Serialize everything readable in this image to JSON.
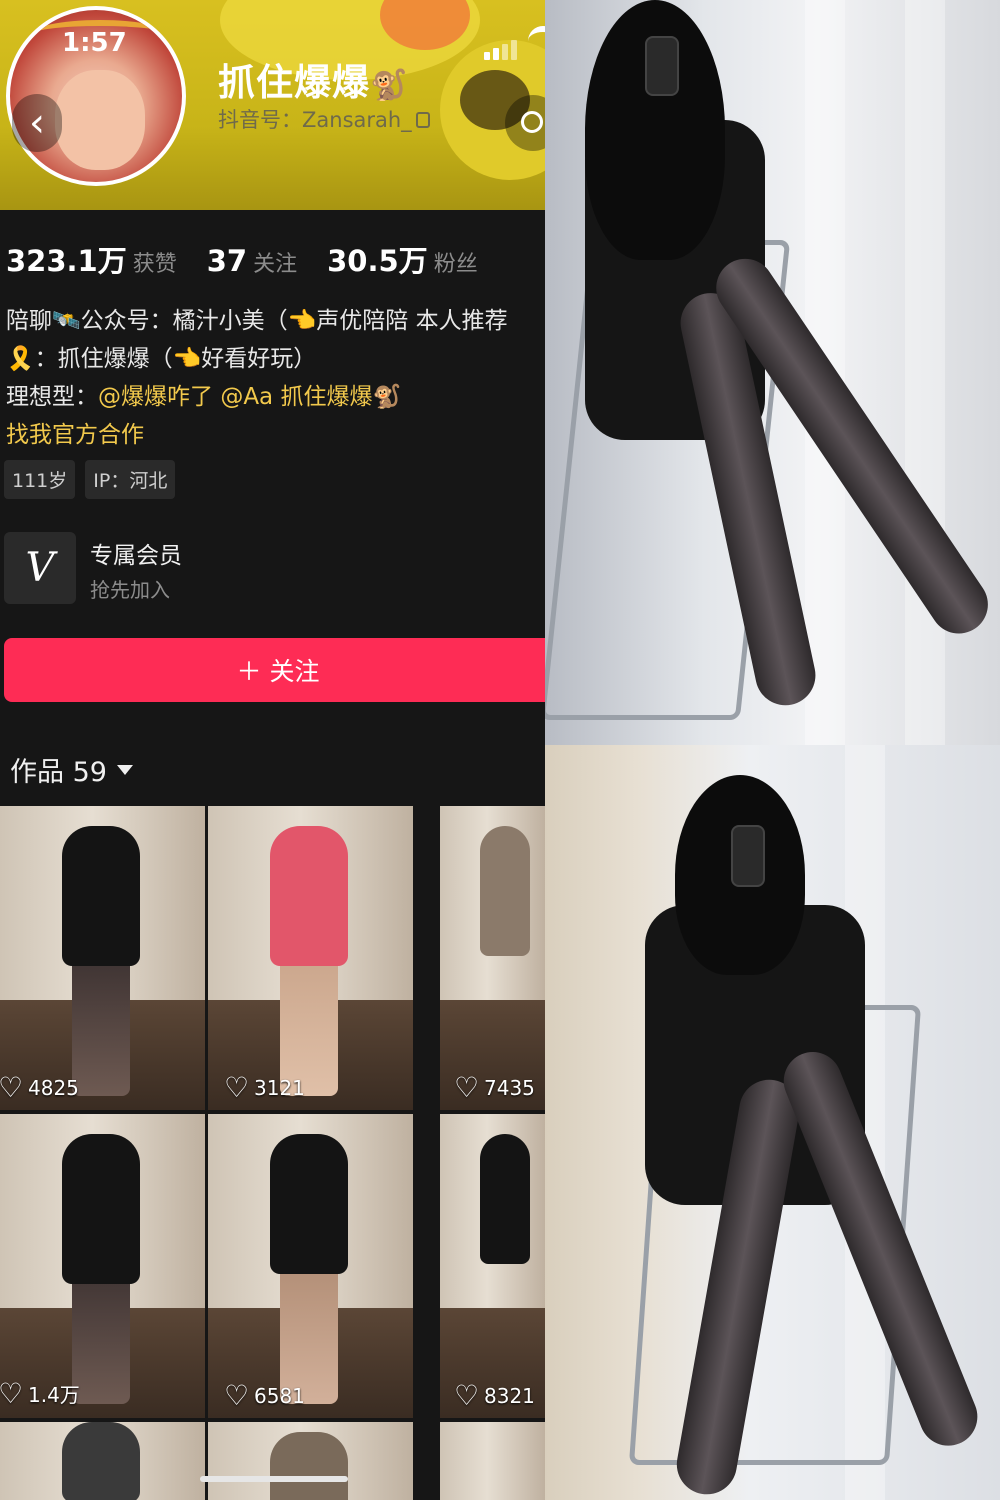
{
  "status": {
    "time": "1:57"
  },
  "profile": {
    "nickname": "抓住爆爆",
    "nickname_emoji": "🐒",
    "user_id": "抖音号：Zansarah_"
  },
  "stats": [
    {
      "value": "323.1万",
      "label": "获赞"
    },
    {
      "value": "37",
      "label": "关注"
    },
    {
      "value": "30.5万",
      "label": "粉丝"
    }
  ],
  "bio": {
    "line1": "陪聊🛰️公众号：橘汁小美（👈声优陪陪 本人推荐",
    "line2": "🎗️：抓住爆爆（👈好看好玩）",
    "line3_prefix": "理想型：",
    "mention1": "@爆爆咋了",
    "mention2": "@Aa 抓住爆爆",
    "mention2_emoji": "🐒",
    "line4_link": "找我官方合作"
  },
  "tags": [
    "111岁",
    "IP：河北"
  ],
  "membership": {
    "icon": "V",
    "title": "专属会员",
    "subtitle": "抢先加入"
  },
  "follow_button": "＋ 关注",
  "works": {
    "label": "作品 59",
    "items": [
      {
        "likes": "4825"
      },
      {
        "likes": "3121"
      },
      {
        "likes": "7435"
      },
      {
        "likes": "1.4万"
      },
      {
        "likes": "6581"
      },
      {
        "likes": "8321"
      }
    ]
  },
  "colors": {
    "follow_button": "#fe2c55",
    "mention": "#f2c94c",
    "background": "#161616",
    "banner": "#d8c020"
  }
}
